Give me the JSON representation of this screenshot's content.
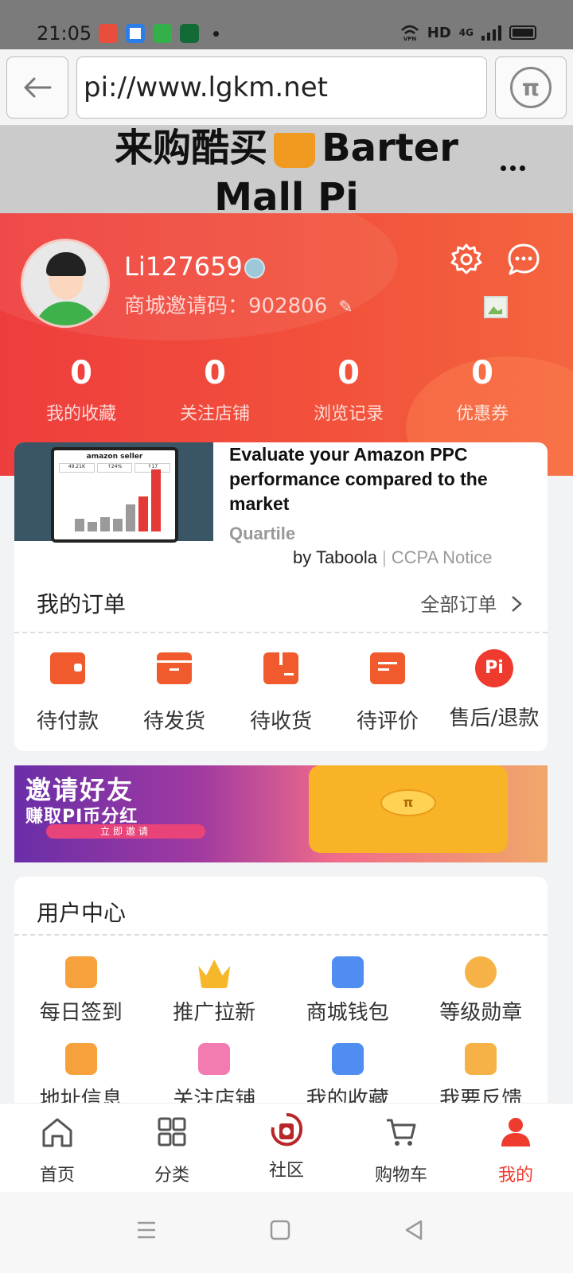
{
  "status_bar": {
    "time": "21:05",
    "right_labels": [
      "HD",
      "4G"
    ],
    "icons": [
      "music-app-icon",
      "browser-app-icon",
      "wechat-app-icon",
      "card-app-icon",
      "vpn-icon",
      "signal-icon",
      "battery-icon"
    ]
  },
  "browser": {
    "url": "pi://www.lgkm.net",
    "back_icon": "arrow-left-icon",
    "pi_icon": "pi-logo-icon",
    "pi_symbol": "π"
  },
  "page_header": {
    "title_line1_left": "来购酷买",
    "title_line1_right": "Barter",
    "title_line2": "Mall Pi",
    "more_icon": "more-dots-icon"
  },
  "profile": {
    "username": "Li127659",
    "invite_label": "商城邀请码：",
    "invite_code": "902806",
    "edit_icon": "✎",
    "stats": [
      {
        "value": "0",
        "label": "我的收藏"
      },
      {
        "value": "0",
        "label": "关注店铺"
      },
      {
        "value": "0",
        "label": "浏览记录"
      },
      {
        "value": "0",
        "label": "优惠券"
      }
    ],
    "colors": {
      "primary": "#ee3d3d",
      "accent": "#f4653f"
    }
  },
  "ad": {
    "title": "Evaluate your Amazon PPC performance compared to the market",
    "source": "Quartile",
    "by": "by Taboola",
    "separator": "|",
    "ccpa": "CCPA Notice",
    "thumb_title": "amazon seller",
    "thumb_kpis": [
      "49.21K",
      "↑24%",
      "↑17"
    ]
  },
  "orders": {
    "title": "我的订单",
    "all_label": "全部订单",
    "chevron": "›",
    "items": [
      {
        "label": "待付款",
        "icon": "wallet-icon"
      },
      {
        "label": "待发货",
        "icon": "box-icon"
      },
      {
        "label": "待收货",
        "icon": "package-icon"
      },
      {
        "label": "待评价",
        "icon": "comment-icon"
      },
      {
        "label": "售后/退款",
        "icon": "refund-pi-icon",
        "badge": "Pi"
      }
    ]
  },
  "banner": {
    "line1": "邀请好友",
    "line2": "赚取PI币分红",
    "button": "立即邀请",
    "coin": "π"
  },
  "user_center": {
    "title": "用户中心",
    "items": [
      {
        "label": "每日签到",
        "icon": "checkin-icon",
        "color": "#f7a13c"
      },
      {
        "label": "推广拉新",
        "icon": "crown-icon",
        "color": "#f6b72a"
      },
      {
        "label": "商城钱包",
        "icon": "wallet-card-icon",
        "color": "#4f8ef0"
      },
      {
        "label": "等级勋章",
        "icon": "medal-icon",
        "color": "#f6b247"
      },
      {
        "label": "地址信息",
        "icon": "address-icon",
        "color": "#f7a13c"
      },
      {
        "label": "关注店铺",
        "icon": "follow-shop-icon",
        "color": "#f27bb0"
      },
      {
        "label": "我的收藏",
        "icon": "favorite-icon",
        "color": "#4f8ef0"
      },
      {
        "label": "我要反馈",
        "icon": "feedback-icon",
        "color": "#f6b247"
      }
    ]
  },
  "bottom_nav": [
    {
      "label": "首页",
      "icon": "home-icon",
      "active": false
    },
    {
      "label": "分类",
      "icon": "category-icon",
      "active": false
    },
    {
      "label": "社区",
      "icon": "community-logo-icon",
      "active": false
    },
    {
      "label": "购物车",
      "icon": "cart-icon",
      "active": false
    },
    {
      "label": "我的",
      "icon": "profile-icon",
      "active": true
    }
  ],
  "system_nav": [
    "menu-icon",
    "home-square-icon",
    "back-triangle-icon"
  ]
}
